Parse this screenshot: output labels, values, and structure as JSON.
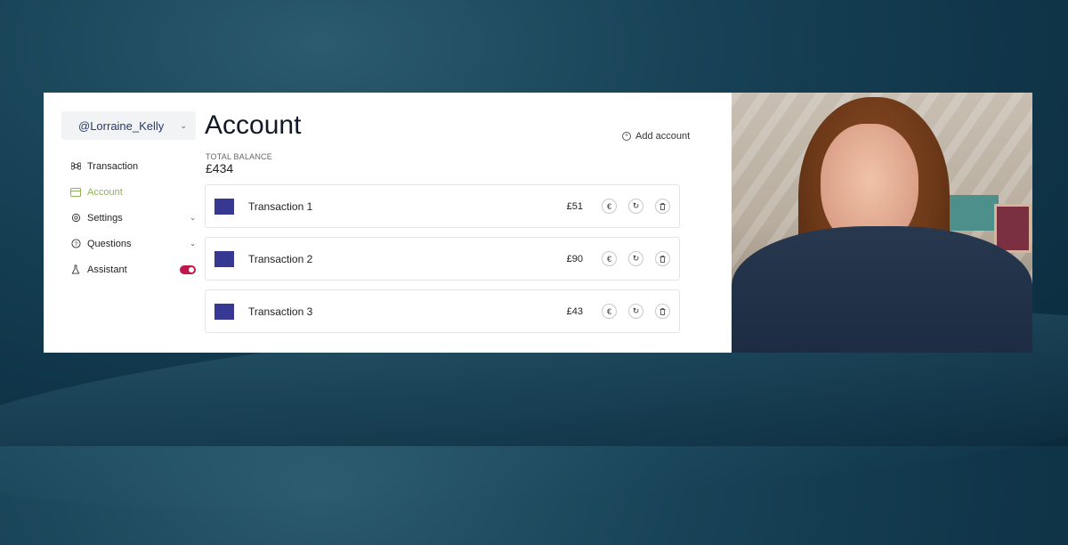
{
  "user": {
    "handle": "@Lorraine_Kelly"
  },
  "nav": [
    {
      "label": "Transaction",
      "icon": "command-icon",
      "active": false,
      "expandable": false
    },
    {
      "label": "Account",
      "icon": "card-icon",
      "active": true,
      "expandable": false
    },
    {
      "label": "Settings",
      "icon": "gear-icon",
      "active": false,
      "expandable": true
    },
    {
      "label": "Questions",
      "icon": "help-icon",
      "active": false,
      "expandable": true
    },
    {
      "label": "Assistant",
      "icon": "flask-icon",
      "active": false,
      "toggle": true,
      "toggle_on": true
    }
  ],
  "page": {
    "title": "Account",
    "add_account_label": "Add account",
    "balance_label": "TOTAL BALANCE",
    "balance_value": "£434"
  },
  "transactions": [
    {
      "name": "Transaction 1",
      "amount": "£51"
    },
    {
      "name": "Transaction 2",
      "amount": "£90"
    },
    {
      "name": "Transaction 3",
      "amount": "£43"
    }
  ],
  "colors": {
    "accent_active": "#8fb35a",
    "swatch": "#363891",
    "toggle": "#c0184b"
  }
}
